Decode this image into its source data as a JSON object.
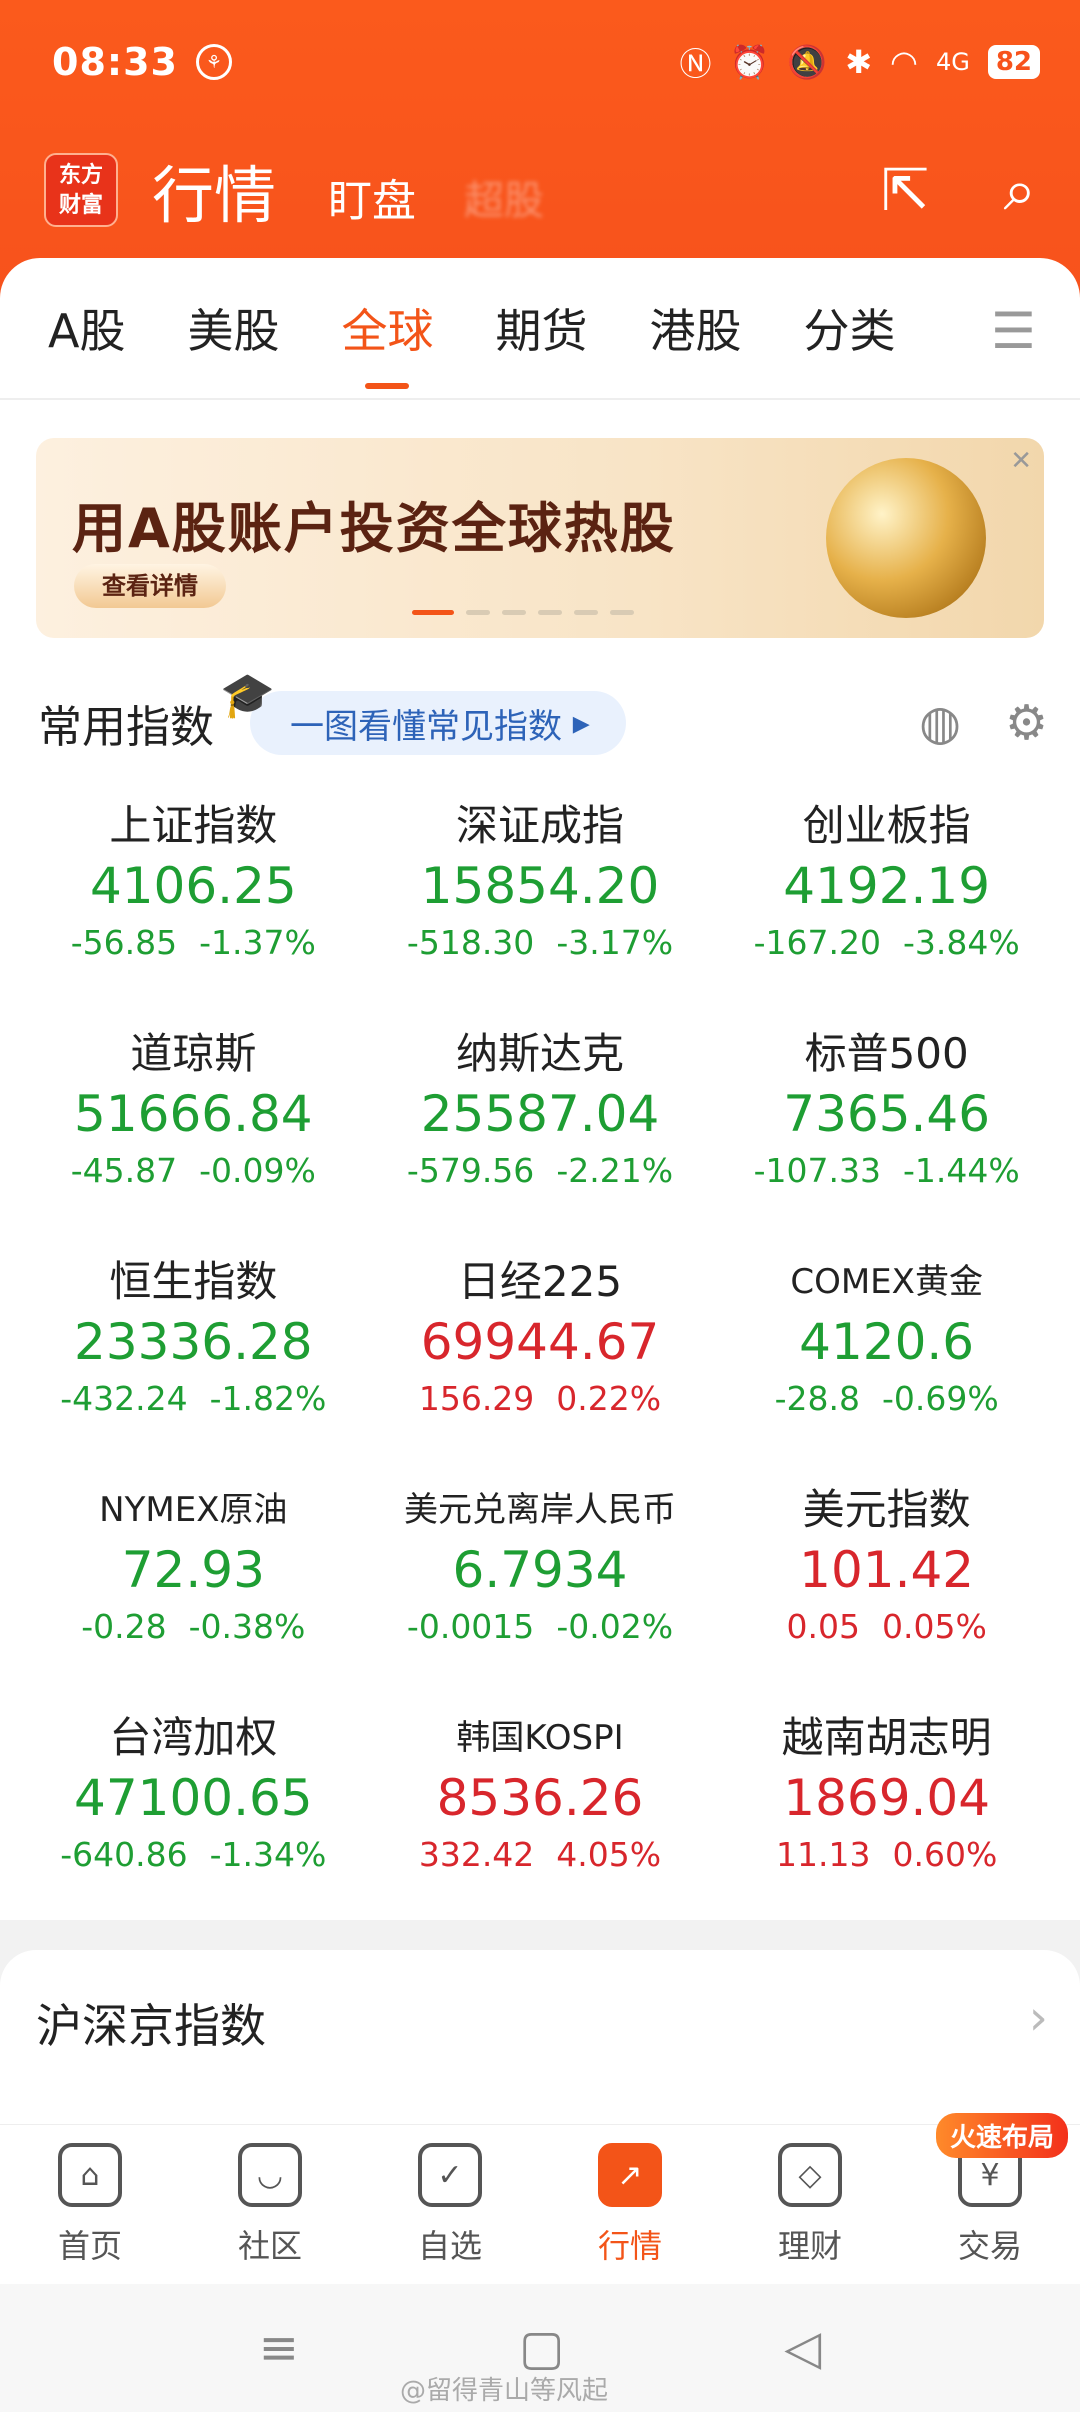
{
  "status_bar": {
    "time": "08:33",
    "battery": "82",
    "network": "4G"
  },
  "header": {
    "logo": "东方\n财富",
    "title": "行情",
    "tab2": "盯盘",
    "tab3": "超股",
    "share_icon": "share-icon",
    "search_icon": "search-icon"
  },
  "tabs": [
    {
      "label": "A股",
      "active": false
    },
    {
      "label": "美股",
      "active": false
    },
    {
      "label": "全球",
      "active": true
    },
    {
      "label": "期货",
      "active": false
    },
    {
      "label": "港股",
      "active": false
    },
    {
      "label": "分类",
      "active": false
    }
  ],
  "banner": {
    "headline": "用A股账户投资全球热股",
    "cta": "查看详情"
  },
  "common_indices": {
    "title": "常用指数",
    "guide": "一图看懂常见指数",
    "items": [
      {
        "name": "上证指数",
        "price": "4106.25",
        "change": "-56.85",
        "pct": "-1.37%",
        "dir": "down"
      },
      {
        "name": "深证成指",
        "price": "15854.20",
        "change": "-518.30",
        "pct": "-3.17%",
        "dir": "down"
      },
      {
        "name": "创业板指",
        "price": "4192.19",
        "change": "-167.20",
        "pct": "-3.84%",
        "dir": "down"
      },
      {
        "name": "道琼斯",
        "price": "51666.84",
        "change": "-45.87",
        "pct": "-0.09%",
        "dir": "down"
      },
      {
        "name": "纳斯达克",
        "price": "25587.04",
        "change": "-579.56",
        "pct": "-2.21%",
        "dir": "down"
      },
      {
        "name": "标普500",
        "price": "7365.46",
        "change": "-107.33",
        "pct": "-1.44%",
        "dir": "down"
      },
      {
        "name": "恒生指数",
        "price": "23336.28",
        "change": "-432.24",
        "pct": "-1.82%",
        "dir": "down"
      },
      {
        "name": "日经225",
        "price": "69944.67",
        "change": "156.29",
        "pct": "0.22%",
        "dir": "up"
      },
      {
        "name": "COMEX黄金",
        "price": "4120.6",
        "change": "-28.8",
        "pct": "-0.69%",
        "dir": "down"
      },
      {
        "name": "NYMEX原油",
        "price": "72.93",
        "change": "-0.28",
        "pct": "-0.38%",
        "dir": "down"
      },
      {
        "name": "美元兑离岸人民币",
        "price": "6.7934",
        "change": "-0.0015",
        "pct": "-0.02%",
        "dir": "down"
      },
      {
        "name": "美元指数",
        "price": "101.42",
        "change": "0.05",
        "pct": "0.05%",
        "dir": "up"
      },
      {
        "name": "台湾加权",
        "price": "47100.65",
        "change": "-640.86",
        "pct": "-1.34%",
        "dir": "down"
      },
      {
        "name": "韩国KOSPI",
        "price": "8536.26",
        "change": "332.42",
        "pct": "4.05%",
        "dir": "up"
      },
      {
        "name": "越南胡志明",
        "price": "1869.04",
        "change": "11.13",
        "pct": "0.60%",
        "dir": "up"
      }
    ]
  },
  "section2": {
    "title": "沪深京指数"
  },
  "bottom_nav": {
    "items": [
      {
        "label": "首页",
        "icon": "home-icon"
      },
      {
        "label": "社区",
        "icon": "community-icon"
      },
      {
        "label": "自选",
        "icon": "watchlist-icon"
      },
      {
        "label": "行情",
        "icon": "market-icon"
      },
      {
        "label": "理财",
        "icon": "wealth-icon"
      },
      {
        "label": "交易",
        "icon": "trade-icon"
      }
    ],
    "badge": "火速布局"
  },
  "watermark": "@留得青山等风起",
  "colors": {
    "brand": "#f7521c",
    "down": "#1e9e33",
    "up": "#d8262c"
  }
}
